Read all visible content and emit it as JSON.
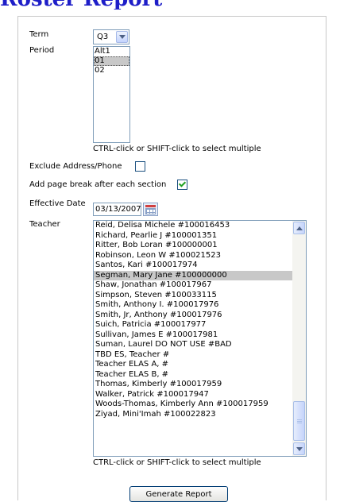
{
  "page": {
    "title": "Roster Report"
  },
  "form": {
    "term": {
      "label": "Term",
      "value": "Q3"
    },
    "period": {
      "label": "Period",
      "options": [
        "Alt1",
        "01",
        "02"
      ],
      "selected": "01",
      "hint": "CTRL-click or SHIFT-click to select multiple"
    },
    "exclude_address": {
      "label": "Exclude Address/Phone",
      "checked": false
    },
    "page_break": {
      "label": "Add page break after each section",
      "checked": true
    },
    "effective_date": {
      "label": "Effective Date",
      "value": "03/13/2007"
    },
    "teacher": {
      "label": "Teacher",
      "options": [
        "Reid, Delisa Michele #100016453",
        "Richard, Pearlie J #100001351",
        "Ritter, Bob Loran #100000001",
        "Robinson, Leon W #100021523",
        "Santos, Kari #100017974",
        "Segman, Mary Jane #100000000",
        "Shaw, Jonathan #100017967",
        "Simpson, Steven #100033115",
        "Smith, Anthony I. #100017976",
        "Smith, Jr, Anthony #100017976",
        "Suich, Patricia #100017977",
        "Sullivan, James E #100017981",
        "Suman, Laurel DO NOT USE #BAD",
        "TBD ES, Teacher #",
        "Teacher ELAS A, #",
        "Teacher ELAS B, #",
        "Thomas, Kimberly #100017959",
        "Walker, Patrick #100017947",
        "Woods-Thomas, Kimberly Ann #100017959",
        "Ziyad, Mini'Imah #100022823"
      ],
      "selected": "Segman, Mary Jane #100000000",
      "hint": "CTRL-click or SHIFT-click to select multiple"
    },
    "generate_label": "Generate Report"
  },
  "icons": {
    "term_dropdown": "chevron-down-icon",
    "calendar": "calendar-icon",
    "scroll_up": "scroll-up-icon",
    "scroll_down": "scroll-down-icon"
  },
  "colors": {
    "title": "#1e1ec8",
    "selection": "#c8c8c8",
    "checkmark": "#21a121",
    "input_border": "#7f9db9"
  }
}
